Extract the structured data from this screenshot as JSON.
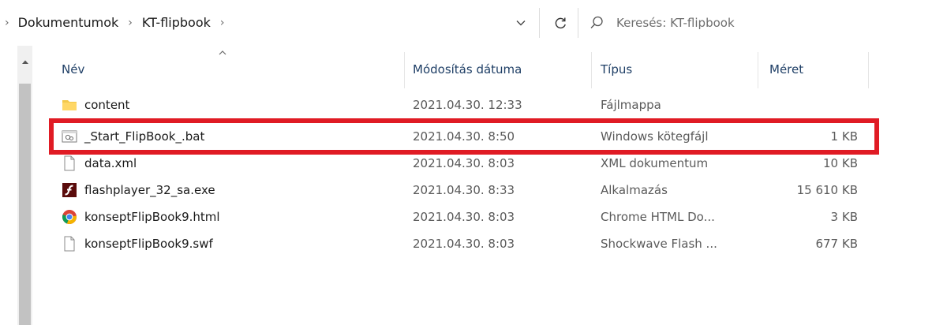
{
  "breadcrumb": {
    "items": [
      "Dokumentumok",
      "KT-flipbook"
    ]
  },
  "search": {
    "placeholder": "Keresés: KT-flipbook"
  },
  "columns": {
    "name": "Név",
    "modified": "Módosítás dátuma",
    "type": "Típus",
    "size": "Méret"
  },
  "files": [
    {
      "name": "content",
      "modified": "2021.04.30. 12:33",
      "type": "Fájlmappa",
      "size": "",
      "icon": "folder-icon"
    },
    {
      "name": "_Start_FlipBook_.bat",
      "modified": "2021.04.30. 8:50",
      "type": "Windows kötegfájl",
      "size": "1 KB",
      "icon": "batch-file-icon"
    },
    {
      "name": "data.xml",
      "modified": "2021.04.30. 8:03",
      "type": "XML dokumentum",
      "size": "10 KB",
      "icon": "document-icon"
    },
    {
      "name": "flashplayer_32_sa.exe",
      "modified": "2021.04.30. 8:33",
      "type": "Alkalmazás",
      "size": "15 610 KB",
      "icon": "flash-icon"
    },
    {
      "name": "konseptFlipBook9.html",
      "modified": "2021.04.30. 8:03",
      "type": "Chrome HTML Do...",
      "size": "3 KB",
      "icon": "chrome-icon"
    },
    {
      "name": "konseptFlipBook9.swf",
      "modified": "2021.04.30. 8:03",
      "type": "Shockwave Flash ...",
      "size": "677 KB",
      "icon": "document-icon"
    }
  ],
  "colors": {
    "highlight": "#e01b24",
    "header_text": "#1f3f66"
  }
}
